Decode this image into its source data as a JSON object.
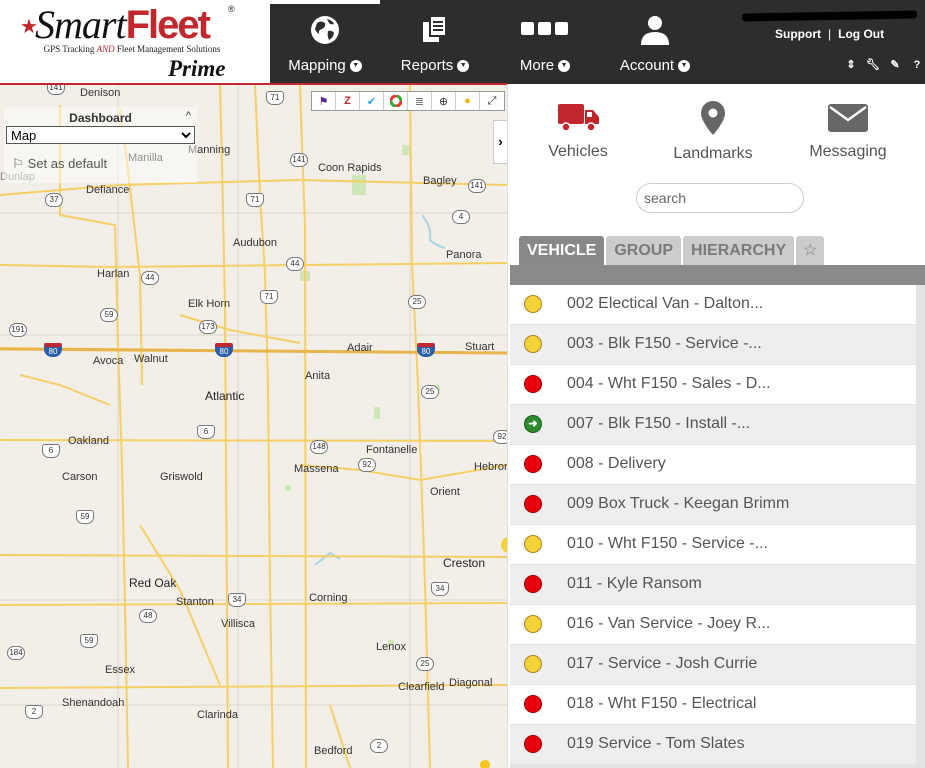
{
  "logo": {
    "brand_a": "Smart",
    "brand_b": "Fleet",
    "reg": "®",
    "tagline_a": "GPS Tracking ",
    "tagline_and": "AND",
    "tagline_b": " Fleet Management Solutions",
    "edition": "Prime"
  },
  "nav": {
    "items": [
      {
        "label": "Mapping",
        "icon": "globe-icon"
      },
      {
        "label": "Reports",
        "icon": "documents-icon"
      },
      {
        "label": "More",
        "icon": "dots-icon"
      },
      {
        "label": "Account",
        "icon": "user-icon"
      }
    ],
    "support": "Support",
    "separator": "|",
    "logout": "Log Out",
    "tool_icons": [
      "sort-icon",
      "wrench-icon",
      "pencil-icon",
      "help-icon"
    ],
    "help": "?"
  },
  "dashboard": {
    "title": "Dashboard",
    "collapse": "^",
    "select_value": "Map",
    "set_default": "Set as default"
  },
  "map": {
    "collapse_arrow": "›",
    "towns": [
      {
        "name": "Denison"
      },
      {
        "name": "Manilla"
      },
      {
        "name": "Manning"
      },
      {
        "name": "Coon Rapids"
      },
      {
        "name": "Bagley"
      },
      {
        "name": "Defiance"
      },
      {
        "name": "Dunlap"
      },
      {
        "name": "Audubon"
      },
      {
        "name": "Panora"
      },
      {
        "name": "Harlan"
      },
      {
        "name": "Elk Horn"
      },
      {
        "name": "Avoca"
      },
      {
        "name": "Walnut"
      },
      {
        "name": "Adair"
      },
      {
        "name": "Stuart"
      },
      {
        "name": "Anita"
      },
      {
        "name": "Atlantic"
      },
      {
        "name": "Oakland"
      },
      {
        "name": "Fontanelle"
      },
      {
        "name": "Carson"
      },
      {
        "name": "Griswold"
      },
      {
        "name": "Massena"
      },
      {
        "name": "Hebron"
      },
      {
        "name": "Orient"
      },
      {
        "name": "Creston"
      },
      {
        "name": "Red Oak"
      },
      {
        "name": "Stanton"
      },
      {
        "name": "Corning"
      },
      {
        "name": "Villisca"
      },
      {
        "name": "Lenox"
      },
      {
        "name": "Essex"
      },
      {
        "name": "Clearfield"
      },
      {
        "name": "Diagonal"
      },
      {
        "name": "Shenandoah"
      },
      {
        "name": "Clarinda"
      },
      {
        "name": "Bedford"
      }
    ],
    "shields": [
      "141",
      "71",
      "141",
      "141",
      "37",
      "71",
      "4",
      "44",
      "191",
      "59",
      "173",
      "71",
      "25",
      "80",
      "80",
      "80",
      "6",
      "25",
      "6",
      "148",
      "92",
      "92",
      "59",
      "34",
      "34",
      "48",
      "59",
      "184",
      "25",
      "2",
      "2"
    ]
  },
  "panel": {
    "tabs": [
      {
        "label": "Vehicles",
        "icon": "truck-icon",
        "color": "#c1272d"
      },
      {
        "label": "Landmarks",
        "icon": "map-pin-icon",
        "color": "#666666"
      },
      {
        "label": "Messaging",
        "icon": "envelope-icon",
        "color": "#666666"
      }
    ],
    "search_placeholder": "search",
    "subtabs": [
      "VEHICLE",
      "GROUP",
      "HIERARCHY"
    ],
    "favorites": "☆"
  },
  "vehicles": [
    {
      "name": "002 Electical Van - Dalton...",
      "status": "yellow"
    },
    {
      "name": "003 - Blk F150 - Service -...",
      "status": "yellow"
    },
    {
      "name": "004 - Wht F150 - Sales - D...",
      "status": "red"
    },
    {
      "name": "007 - Blk F150 - Install -...",
      "status": "green-moving"
    },
    {
      "name": "008 - Delivery",
      "status": "red"
    },
    {
      "name": "009 Box Truck - Keegan Brimm",
      "status": "red"
    },
    {
      "name": "010 - Wht F150 - Service -...",
      "status": "yellow"
    },
    {
      "name": "011 - Kyle Ransom",
      "status": "red"
    },
    {
      "name": "016 - Van Service - Joey R...",
      "status": "yellow"
    },
    {
      "name": "017 - Service - Josh Currie",
      "status": "yellow"
    },
    {
      "name": "018 - Wht F150 - Electrical",
      "status": "red"
    },
    {
      "name": "019 Service - Tom Slates",
      "status": "red"
    }
  ],
  "colors": {
    "brand_red": "#c1272d",
    "header_dark": "#2d2d2d",
    "status_yellow": "#f5d13a",
    "status_red": "#e8000b",
    "status_green": "#2e8b2e"
  }
}
